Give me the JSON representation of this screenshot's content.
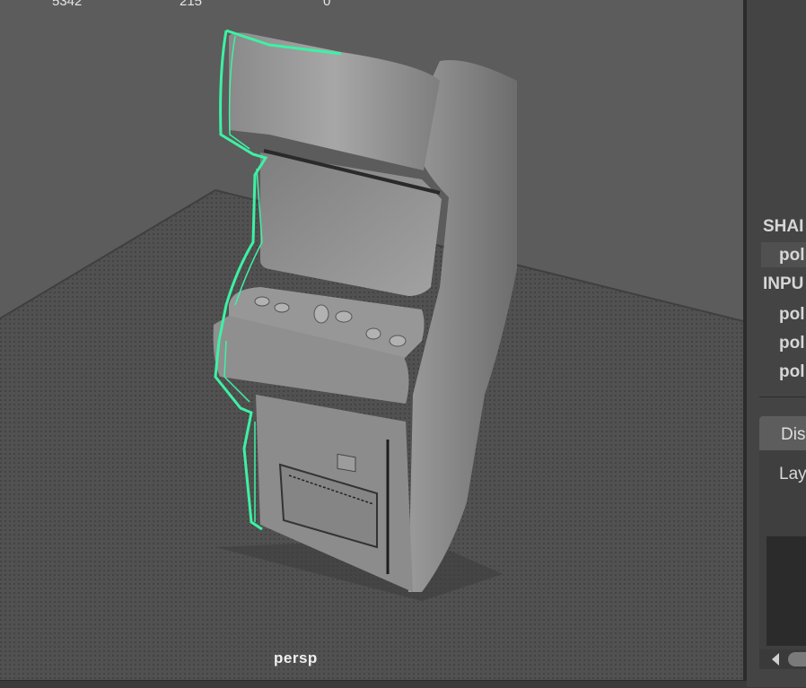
{
  "viewport": {
    "hud_values": [
      "5342",
      "215",
      "0"
    ],
    "camera_label": "persp"
  },
  "channel_box": {
    "shapes_header": "SHAI",
    "shape_items": [
      "pol"
    ],
    "inputs_header": "INPU",
    "input_items": [
      "pol",
      "pol",
      "pol"
    ]
  },
  "layer_editor": {
    "tab_label": "Dis",
    "layers_label": "Lay"
  },
  "colors": {
    "selection_highlight": "#3df2a4",
    "viewport_background": "#5b5b5b",
    "panel_background": "#444444"
  }
}
